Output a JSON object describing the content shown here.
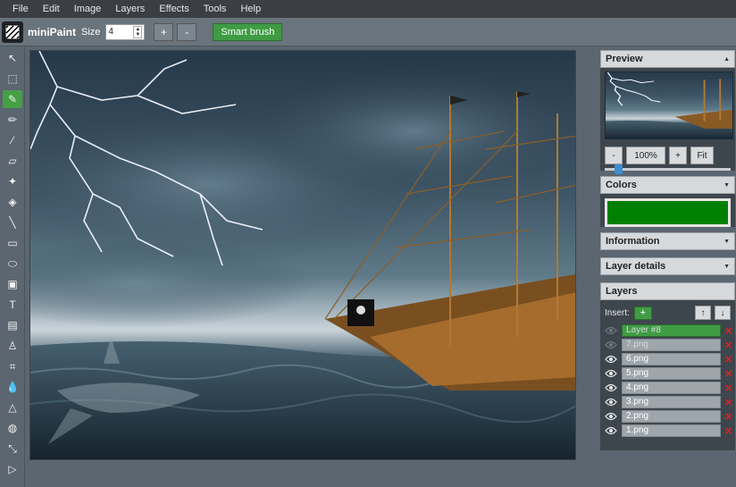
{
  "menu": [
    "File",
    "Edit",
    "Image",
    "Layers",
    "Effects",
    "Tools",
    "Help"
  ],
  "app": {
    "name": "miniPaint"
  },
  "toolbar": {
    "size_label": "Size",
    "size_value": "4",
    "plus_label": "+",
    "minus_label": "-",
    "smart_brush_label": "Smart brush"
  },
  "tools": [
    {
      "name": "select-icon",
      "glyph": "↖"
    },
    {
      "name": "marquee-select-icon",
      "glyph": "⬚"
    },
    {
      "name": "magic-brush-icon",
      "glyph": "✎"
    },
    {
      "name": "pencil-icon",
      "glyph": "✏"
    },
    {
      "name": "eyedropper-icon",
      "glyph": "⁄"
    },
    {
      "name": "eraser-icon",
      "glyph": "▱"
    },
    {
      "name": "magic-wand-icon",
      "glyph": "✦"
    },
    {
      "name": "fill-bucket-icon",
      "glyph": "◈"
    },
    {
      "name": "line-icon",
      "glyph": "╲"
    },
    {
      "name": "rectangle-icon",
      "glyph": "▭"
    },
    {
      "name": "ellipse-icon",
      "glyph": "⬭"
    },
    {
      "name": "image-icon",
      "glyph": "▣"
    },
    {
      "name": "text-icon",
      "glyph": "T"
    },
    {
      "name": "gradient-icon",
      "glyph": "▤"
    },
    {
      "name": "clone-stamp-icon",
      "glyph": "♙"
    },
    {
      "name": "crop-icon",
      "glyph": "⌗"
    },
    {
      "name": "blur-icon",
      "glyph": "💧"
    },
    {
      "name": "sharpen-icon",
      "glyph": "△"
    },
    {
      "name": "bulge-icon",
      "glyph": "◍"
    },
    {
      "name": "shrink-icon",
      "glyph": "⤡"
    },
    {
      "name": "animation-icon",
      "glyph": "▷"
    }
  ],
  "active_tool_index": 2,
  "preview": {
    "title": "Preview",
    "zoom_minus": "-",
    "zoom_value": "100%",
    "zoom_plus": "+",
    "fit_label": "Fit",
    "zoom_fraction": 0.08
  },
  "colors": {
    "title": "Colors",
    "active_color": "#008000"
  },
  "information": {
    "title": "Information"
  },
  "layer_details": {
    "title": "Layer details"
  },
  "layers": {
    "title": "Layers",
    "insert_label": "Insert:",
    "add_label": "+",
    "up_label": "↑",
    "down_label": "↓",
    "delete_glyph": "✕",
    "items": [
      {
        "label": "Layer #8",
        "selected": true,
        "visible": false
      },
      {
        "label": "7.png",
        "selected": false,
        "visible": false
      },
      {
        "label": "6.png",
        "selected": false,
        "visible": true
      },
      {
        "label": "5.png",
        "selected": false,
        "visible": true
      },
      {
        "label": "4.png",
        "selected": false,
        "visible": true
      },
      {
        "label": "3.png",
        "selected": false,
        "visible": true
      },
      {
        "label": "2.png",
        "selected": false,
        "visible": true
      },
      {
        "label": "1.png",
        "selected": false,
        "visible": true
      }
    ]
  },
  "accent_color": "#46a046"
}
